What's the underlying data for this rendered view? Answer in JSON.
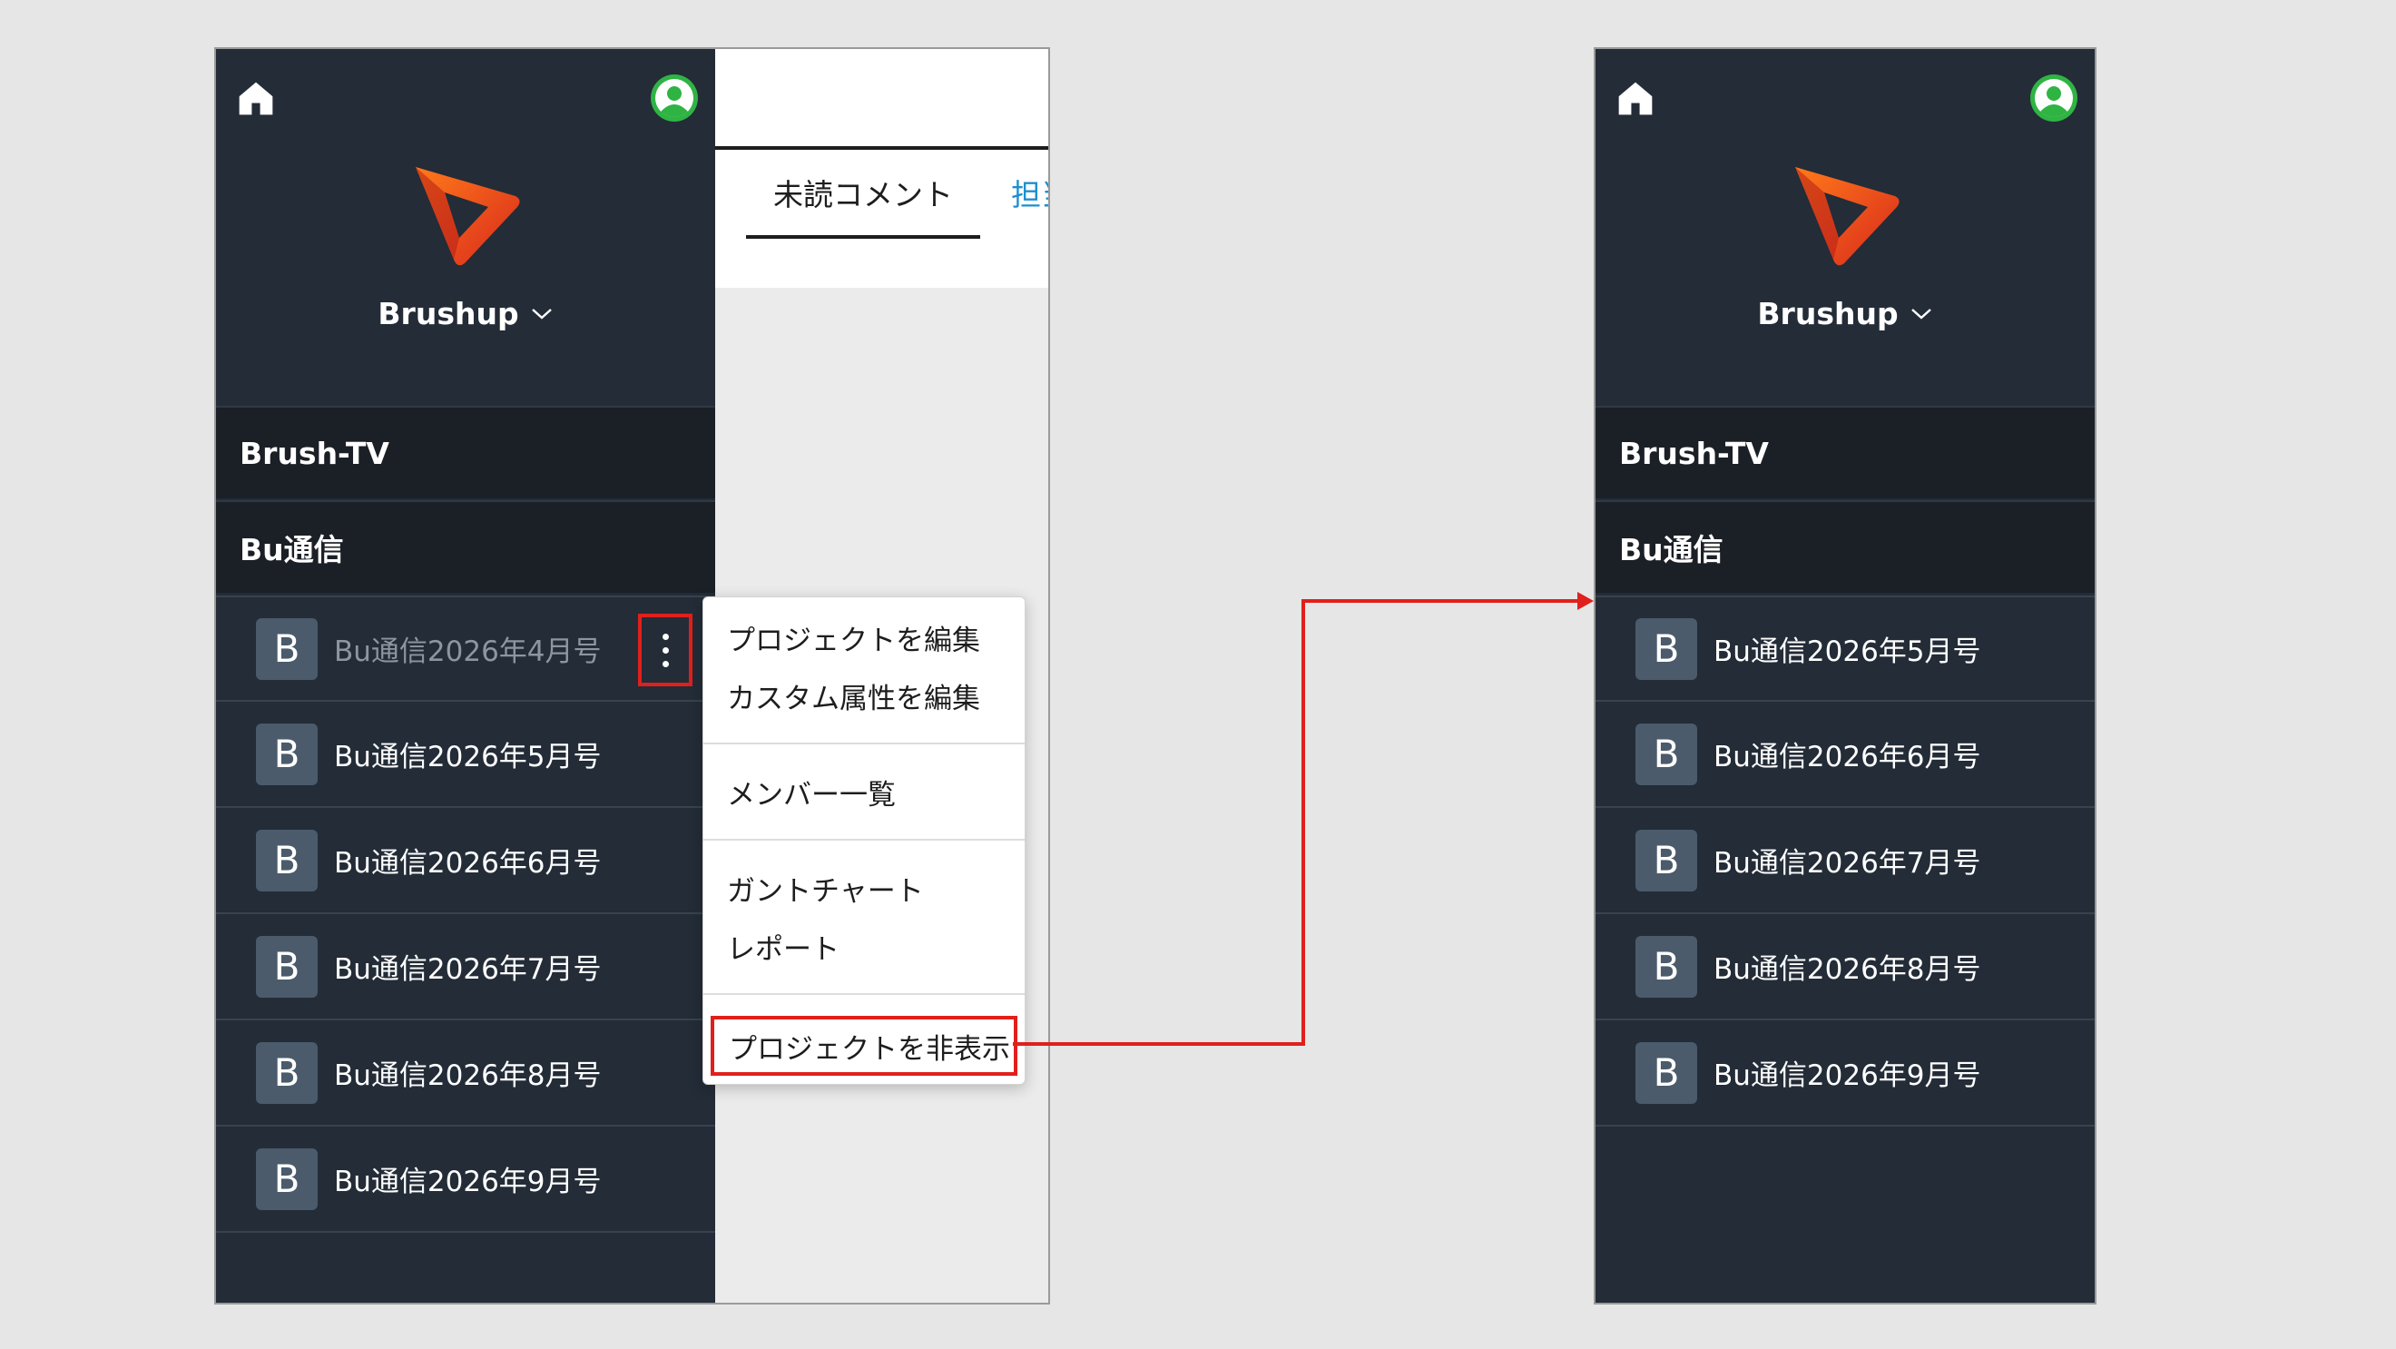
{
  "app": {
    "org_name": "Brushup",
    "logo_icon": "brushup-logo-icon",
    "home_icon": "home-icon",
    "avatar_icon": "user-avatar-icon",
    "colors": {
      "sidebar_bg": "#232c37",
      "group_bg": "#1b1f26",
      "badge_bg": "#4b5b6b",
      "highlight": "#e0201c",
      "link_blue": "#1e8fd0",
      "avatar_green": "#2fb443"
    }
  },
  "left_panel": {
    "groups": [
      "Brush-TV",
      "Bu通信"
    ],
    "projects": [
      {
        "badge": "B",
        "name": "Bu通信2026年4月号"
      },
      {
        "badge": "B",
        "name": "Bu通信2026年5月号"
      },
      {
        "badge": "B",
        "name": "Bu通信2026年6月号"
      },
      {
        "badge": "B",
        "name": "Bu通信2026年7月号"
      },
      {
        "badge": "B",
        "name": "Bu通信2026年8月号"
      },
      {
        "badge": "B",
        "name": "Bu通信2026年9月号"
      }
    ],
    "tabs": {
      "unread": "未読コメント",
      "assigned": "担当"
    },
    "context_menu": {
      "edit_project": "プロジェクトを編集",
      "edit_custom_attr": "カスタム属性を編集",
      "member_list": "メンバー一覧",
      "gantt_chart": "ガントチャート",
      "report": "レポート",
      "hide_project": "プロジェクトを非表示"
    }
  },
  "right_panel": {
    "groups": [
      "Brush-TV",
      "Bu通信"
    ],
    "projects": [
      {
        "badge": "B",
        "name": "Bu通信2026年5月号"
      },
      {
        "badge": "B",
        "name": "Bu通信2026年6月号"
      },
      {
        "badge": "B",
        "name": "Bu通信2026年7月号"
      },
      {
        "badge": "B",
        "name": "Bu通信2026年8月号"
      },
      {
        "badge": "B",
        "name": "Bu通信2026年9月号"
      }
    ]
  }
}
